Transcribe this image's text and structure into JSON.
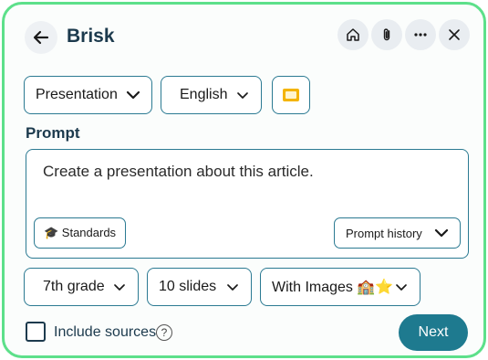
{
  "header": {
    "title": "Brisk",
    "back_icon": "arrow-left-icon",
    "buttons": [
      "home-icon",
      "paperclip-icon",
      "more-horizontal-icon",
      "close-icon"
    ]
  },
  "toolbar": {
    "output_type": "Presentation",
    "language": "English",
    "slides_icon": "google-slides-icon",
    "slides_icon_color": "#f4b400"
  },
  "prompt": {
    "label": "Prompt",
    "text": "Create a presentation about this article.",
    "standards_label": "🎓 Standards",
    "history_label": "Prompt history"
  },
  "options": {
    "grade": "7th grade",
    "slides": "10 slides",
    "images": "With Images 🏫⭐"
  },
  "footer": {
    "include_sources_label": "Include sources",
    "include_sources_checked": false,
    "help_glyph": "?",
    "next_label": "Next"
  },
  "colors": {
    "border_accent": "#5de08a",
    "primary": "#1e7a8f",
    "field_border": "#2b7a92"
  }
}
